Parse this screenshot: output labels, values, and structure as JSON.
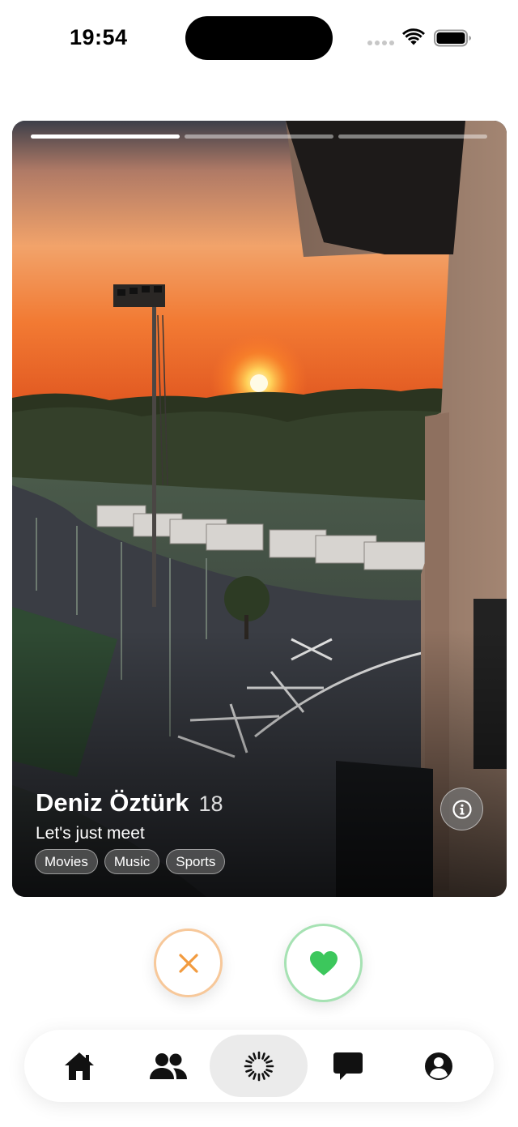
{
  "status_bar": {
    "time": "19:54"
  },
  "card": {
    "photo_count": 3,
    "active_photo": 1,
    "name": "Deniz Öztürk",
    "age": "18",
    "bio": "Let's just meet",
    "tags": [
      "Movies",
      "Music",
      "Sports"
    ],
    "info_icon": "info-icon"
  },
  "actions": {
    "pass_icon": "close-icon",
    "like_icon": "heart-icon",
    "pass_color": "#f29b3f",
    "like_color": "#3cc75c"
  },
  "tab_bar": {
    "items": [
      {
        "icon": "home-icon",
        "active": false
      },
      {
        "icon": "people-icon",
        "active": false
      },
      {
        "icon": "discover-icon",
        "active": true
      },
      {
        "icon": "chat-icon",
        "active": false
      },
      {
        "icon": "profile-icon",
        "active": false
      }
    ]
  }
}
